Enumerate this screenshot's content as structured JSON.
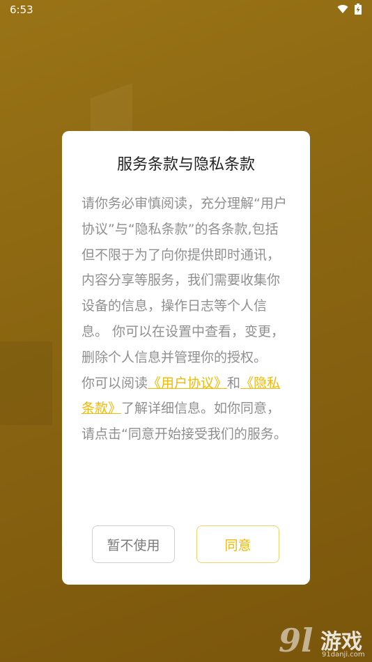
{
  "status_bar": {
    "time": "6:53"
  },
  "dialog": {
    "title": "服务条款与隐私条款",
    "paragraph1": "请你务必审慎阅读，充分理解“用户协议”与“隐私条款”的各条款,包括但不限于为了向你提供即时通讯，内容分享等服务，我们需要收集你设备的信息，操作日志等个人信息。 你可以在设置中查看，变更，删除个人信息并管理你的授权。",
    "p2_prefix": "你可以阅读",
    "link_user_agreement": "《用户协议》",
    "p2_and": "和",
    "link_privacy": "《隐私条款》",
    "p2_suffix": "了解详细信息。如你同意，请点击“同意开始接受我们的服务。",
    "decline_button": "暂不使用",
    "agree_button": "同意"
  },
  "colors": {
    "accent": "#f5b800",
    "background": "#8a6511"
  },
  "watermark": {
    "logo": "9l",
    "name": "游戏",
    "url": "91danji.com"
  }
}
